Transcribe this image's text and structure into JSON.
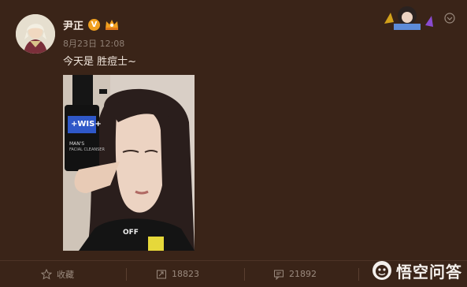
{
  "user": {
    "name": "尹正",
    "verified_badge": "V"
  },
  "post": {
    "date": "8月23日",
    "time": "12:08",
    "text": "今天是 胜痘士~",
    "photo": {
      "bottle_label": "+WIS+",
      "bottle_sub": "MAN'S",
      "bottle_sub2": "FACIAL CLEANSER",
      "shirt_text": "OFF"
    }
  },
  "actions": {
    "favorite_label": "收藏",
    "repost_count": "18823",
    "comment_count": "21892"
  },
  "watermark": {
    "text": "悟空问答"
  },
  "colors": {
    "background": "#3a2418",
    "accent_orange": "#f0a020"
  }
}
